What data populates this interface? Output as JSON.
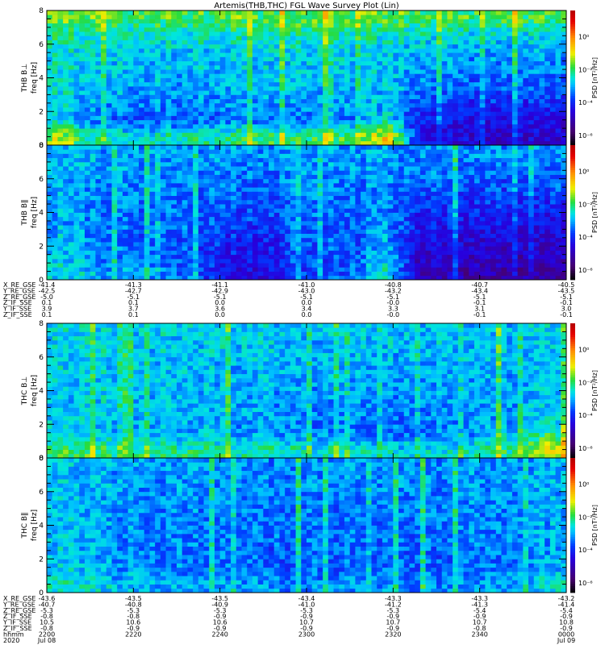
{
  "chart_data": {
    "type": "heatmap",
    "title": "Artemis(THB,THC) FGL Wave Survey Plot (Lin)",
    "time_axis": {
      "label": "hhmm",
      "year": "2020",
      "ticks": [
        "2200",
        "2220",
        "2240",
        "2300",
        "2320",
        "2340",
        "0000"
      ],
      "dates": [
        "Jul 08",
        "Jul 09"
      ],
      "range_minutes": [
        0,
        120
      ]
    },
    "freq_axis": {
      "label": "freq [Hz]",
      "range": [
        0,
        8
      ],
      "ticks": [
        "0",
        "2",
        "4",
        "6",
        "8"
      ]
    },
    "colorbar": {
      "label": "PSD [nT²/Hz]",
      "log10_range": [
        -6.6,
        1.6
      ],
      "ticks": [
        {
          "exp": 0,
          "label": "10⁰"
        },
        {
          "exp": -2,
          "label": "10⁻²"
        },
        {
          "exp": -4,
          "label": "10⁻⁴"
        },
        {
          "exp": -6,
          "label": "10⁻⁶"
        }
      ]
    },
    "panels": [
      {
        "name": "THB B⊥",
        "ylabel": "freq [Hz]",
        "log10_psd": [
          [
            -1.4,
            -2.3,
            -2.5,
            -2.4,
            -2.2,
            -2.0,
            -1.9,
            -2.0,
            -2.0,
            -1.9,
            -0.6,
            -4.4,
            -4.6,
            -4.6,
            -4.7,
            -4.7
          ],
          [
            -2.8,
            -3.4,
            -3.6,
            -3.6,
            -3.6,
            -3.3,
            -3.5,
            -3.4,
            -3.5,
            -3.4,
            -2.6,
            -4.2,
            -4.3,
            -4.4,
            -4.4,
            -4.4
          ],
          [
            -2.7,
            -3.1,
            -3.2,
            -3.2,
            -3.2,
            -3.0,
            -3.2,
            -3.1,
            -3.2,
            -3.1,
            -2.8,
            -3.8,
            -3.9,
            -4.0,
            -4.0,
            -4.0
          ],
          [
            -2.6,
            -2.9,
            -3.0,
            -3.0,
            -3.0,
            -2.9,
            -3.0,
            -2.9,
            -3.0,
            -3.0,
            -2.8,
            -3.4,
            -3.5,
            -3.5,
            -3.6,
            -3.6
          ],
          [
            -2.6,
            -2.8,
            -2.9,
            -2.9,
            -2.9,
            -2.8,
            -2.9,
            -2.8,
            -2.9,
            -2.9,
            -2.8,
            -3.2,
            -3.2,
            -3.3,
            -3.3,
            -3.3
          ],
          [
            -2.6,
            -2.7,
            -2.8,
            -2.8,
            -2.8,
            -2.7,
            -2.8,
            -2.7,
            -2.8,
            -2.8,
            -2.7,
            -3.0,
            -3.0,
            -3.1,
            -3.1,
            -3.1
          ],
          [
            -2.3,
            -2.4,
            -2.5,
            -2.5,
            -2.5,
            -2.4,
            -2.5,
            -2.4,
            -2.5,
            -2.5,
            -2.4,
            -2.6,
            -2.6,
            -2.7,
            -2.7,
            -2.7
          ],
          [
            -1.7,
            -1.7,
            -1.8,
            -1.8,
            -1.8,
            -1.7,
            -1.8,
            -1.7,
            -1.8,
            -1.8,
            -1.7,
            -1.9,
            -1.9,
            -1.9,
            -1.9,
            -1.9
          ]
        ]
      },
      {
        "name": "THB B∥",
        "ylabel": "freq [Hz]",
        "log10_psd": [
          [
            -2.6,
            -3.0,
            -3.2,
            -3.4,
            -3.4,
            -4.4,
            -4.4,
            -4.2,
            -3.6,
            -3.5,
            -2.4,
            -5.0,
            -5.0,
            -5.1,
            -5.2,
            -5.2
          ],
          [
            -2.8,
            -3.2,
            -3.5,
            -3.6,
            -3.6,
            -4.2,
            -4.2,
            -4.0,
            -3.7,
            -3.6,
            -2.8,
            -4.7,
            -4.8,
            -4.8,
            -4.9,
            -4.9
          ],
          [
            -2.9,
            -3.3,
            -3.5,
            -3.6,
            -3.6,
            -4.0,
            -4.0,
            -3.9,
            -3.6,
            -3.6,
            -3.0,
            -4.4,
            -4.5,
            -4.5,
            -4.6,
            -4.6
          ],
          [
            -3.0,
            -3.3,
            -3.5,
            -3.5,
            -3.5,
            -3.8,
            -3.8,
            -3.7,
            -3.5,
            -3.5,
            -3.2,
            -4.1,
            -4.2,
            -4.2,
            -4.3,
            -4.3
          ],
          [
            -3.0,
            -3.3,
            -3.4,
            -3.4,
            -3.4,
            -3.6,
            -3.6,
            -3.6,
            -3.4,
            -3.4,
            -3.2,
            -3.9,
            -3.9,
            -4.0,
            -4.0,
            -4.0
          ],
          [
            -3.0,
            -3.2,
            -3.3,
            -3.3,
            -3.3,
            -3.5,
            -3.5,
            -3.4,
            -3.3,
            -3.3,
            -3.2,
            -3.6,
            -3.7,
            -3.7,
            -3.7,
            -3.7
          ],
          [
            -3.0,
            -3.1,
            -3.2,
            -3.2,
            -3.2,
            -3.3,
            -3.3,
            -3.3,
            -3.2,
            -3.2,
            -3.1,
            -3.4,
            -3.4,
            -3.4,
            -3.4,
            -3.4
          ],
          [
            -2.9,
            -3.0,
            -3.1,
            -3.1,
            -3.1,
            -3.2,
            -3.2,
            -3.2,
            -3.1,
            -3.1,
            -3.1,
            -3.2,
            -3.2,
            -3.2,
            -3.2,
            -3.2
          ]
        ]
      },
      {
        "name": "THC B⊥",
        "ylabel": "freq [Hz]",
        "log10_psd": [
          [
            -1.8,
            -2.0,
            -2.1,
            -2.1,
            -2.2,
            -2.2,
            -2.3,
            -2.3,
            -2.4,
            -2.5,
            -2.6,
            -2.6,
            -2.5,
            -2.3,
            -2.0,
            -1.0
          ],
          [
            -2.6,
            -2.8,
            -2.9,
            -2.9,
            -3.0,
            -3.0,
            -3.1,
            -3.2,
            -3.3,
            -3.4,
            -3.4,
            -3.4,
            -3.3,
            -3.1,
            -2.8,
            -2.2
          ],
          [
            -2.7,
            -2.8,
            -2.9,
            -2.9,
            -3.0,
            -3.0,
            -3.1,
            -3.2,
            -3.3,
            -3.3,
            -3.3,
            -3.3,
            -3.2,
            -3.1,
            -3.0,
            -2.8
          ],
          [
            -2.7,
            -2.8,
            -2.8,
            -2.9,
            -2.9,
            -3.0,
            -3.0,
            -3.1,
            -3.2,
            -3.2,
            -3.2,
            -3.2,
            -3.1,
            -3.1,
            -3.0,
            -2.9
          ],
          [
            -2.7,
            -2.8,
            -2.8,
            -2.8,
            -2.9,
            -2.9,
            -3.0,
            -3.0,
            -3.1,
            -3.1,
            -3.1,
            -3.1,
            -3.0,
            -3.0,
            -3.0,
            -2.9
          ],
          [
            -2.7,
            -2.7,
            -2.8,
            -2.8,
            -2.8,
            -2.9,
            -2.9,
            -2.9,
            -3.0,
            -3.0,
            -3.0,
            -3.0,
            -3.0,
            -2.9,
            -2.9,
            -2.9
          ],
          [
            -2.7,
            -2.7,
            -2.8,
            -2.8,
            -2.8,
            -2.8,
            -2.8,
            -2.9,
            -2.9,
            -2.9,
            -2.9,
            -2.9,
            -2.9,
            -2.9,
            -2.9,
            -2.9
          ],
          [
            -2.6,
            -2.7,
            -2.7,
            -2.7,
            -2.7,
            -2.7,
            -2.8,
            -2.8,
            -2.8,
            -2.8,
            -2.8,
            -2.8,
            -2.8,
            -2.8,
            -2.8,
            -2.8
          ]
        ]
      },
      {
        "name": "THC B∥",
        "ylabel": "freq [Hz]",
        "log10_psd": [
          [
            -2.4,
            -2.7,
            -2.9,
            -3.0,
            -3.1,
            -3.1,
            -3.1,
            -3.2,
            -3.2,
            -3.2,
            -3.2,
            -3.2,
            -3.2,
            -3.1,
            -3.0,
            -2.6
          ],
          [
            -2.7,
            -3.0,
            -3.2,
            -3.3,
            -3.4,
            -3.4,
            -3.5,
            -3.5,
            -3.5,
            -3.5,
            -3.5,
            -3.5,
            -3.5,
            -3.4,
            -3.3,
            -2.9
          ],
          [
            -2.8,
            -3.1,
            -3.3,
            -3.3,
            -3.4,
            -3.4,
            -3.5,
            -3.5,
            -3.5,
            -3.5,
            -3.5,
            -3.5,
            -3.5,
            -3.4,
            -3.3,
            -3.0
          ],
          [
            -2.8,
            -3.1,
            -3.2,
            -3.3,
            -3.4,
            -3.4,
            -3.4,
            -3.4,
            -3.4,
            -3.4,
            -3.4,
            -3.4,
            -3.4,
            -3.3,
            -3.2,
            -3.0
          ],
          [
            -2.8,
            -3.1,
            -3.2,
            -3.3,
            -3.3,
            -3.3,
            -3.3,
            -3.4,
            -3.4,
            -3.4,
            -3.4,
            -3.4,
            -3.3,
            -3.3,
            -3.2,
            -3.0
          ],
          [
            -2.8,
            -3.0,
            -3.2,
            -3.2,
            -3.3,
            -3.3,
            -3.3,
            -3.3,
            -3.3,
            -3.3,
            -3.3,
            -3.3,
            -3.3,
            -3.2,
            -3.2,
            -3.0
          ],
          [
            -2.8,
            -3.0,
            -3.1,
            -3.2,
            -3.2,
            -3.2,
            -3.2,
            -3.2,
            -3.2,
            -3.2,
            -3.2,
            -3.2,
            -3.2,
            -3.2,
            -3.1,
            -3.0
          ],
          [
            -2.8,
            -3.0,
            -3.1,
            -3.1,
            -3.2,
            -3.2,
            -3.2,
            -3.2,
            -3.2,
            -3.2,
            -3.2,
            -3.2,
            -3.2,
            -3.1,
            -3.1,
            -3.0
          ]
        ]
      }
    ],
    "ephemeris": [
      {
        "rows": [
          {
            "label": "X_RE_GSE",
            "values": [
              "-41.4",
              "-41.3",
              "-41.1",
              "-41.0",
              "-40.8",
              "-40.7",
              "-40.5"
            ]
          },
          {
            "label": "Y_RE_GSE",
            "values": [
              "-42.5",
              "-42.7",
              "-42.9",
              "-43.0",
              "-43.2",
              "-43.4",
              "-43.5"
            ]
          },
          {
            "label": "Z_RE_GSE",
            "values": [
              "-5.0",
              "-5.1",
              "-5.1",
              "-5.1",
              "-5.1",
              "-5.1",
              "-5.1"
            ]
          },
          {
            "label": "Z_IF_SSE",
            "values": [
              "0.1",
              "0.1",
              "0.0",
              "0.0",
              "-0.0",
              "-0.1",
              "-0.1"
            ]
          },
          {
            "label": "Y_IF_SSE",
            "values": [
              "3.9",
              "3.7",
              "3.6",
              "3.4",
              "3.3",
              "3.1",
              "3.0"
            ]
          },
          {
            "label": "Z_IF_SSE",
            "values": [
              "0.1",
              "0.1",
              "0.0",
              "0.0",
              "-0.0",
              "-0.1",
              "-0.1"
            ]
          }
        ]
      },
      {
        "rows": [
          {
            "label": "X_RE_GSE",
            "values": [
              "-43.6",
              "-43.5",
              "-43.5",
              "-43.4",
              "-43.3",
              "-43.3",
              "-43.2"
            ]
          },
          {
            "label": "Y_RE_GSE",
            "values": [
              "-40.7",
              "-40.8",
              "-40.9",
              "-41.0",
              "-41.2",
              "-41.3",
              "-41.4"
            ]
          },
          {
            "label": "Z_RE_GSE",
            "values": [
              "-5.3",
              "-5.3",
              "-5.3",
              "-5.3",
              "-5.3",
              "-5.4",
              "-5.4"
            ]
          },
          {
            "label": "Z_IF_SSE",
            "values": [
              "-0.8",
              "-0.8",
              "-0.9",
              "-0.9",
              "-0.9",
              "-0.9",
              "-0.9"
            ]
          },
          {
            "label": "Y_IF_SSE",
            "values": [
              "10.5",
              "10.6",
              "10.6",
              "10.7",
              "10.7",
              "10.7",
              "10.8"
            ]
          },
          {
            "label": "Z_IF_SSE",
            "values": [
              "-0.8",
              "-0.9",
              "-0.9",
              "-0.9",
              "-0.9",
              "-0.8",
              "-0.9"
            ]
          }
        ]
      }
    ]
  }
}
